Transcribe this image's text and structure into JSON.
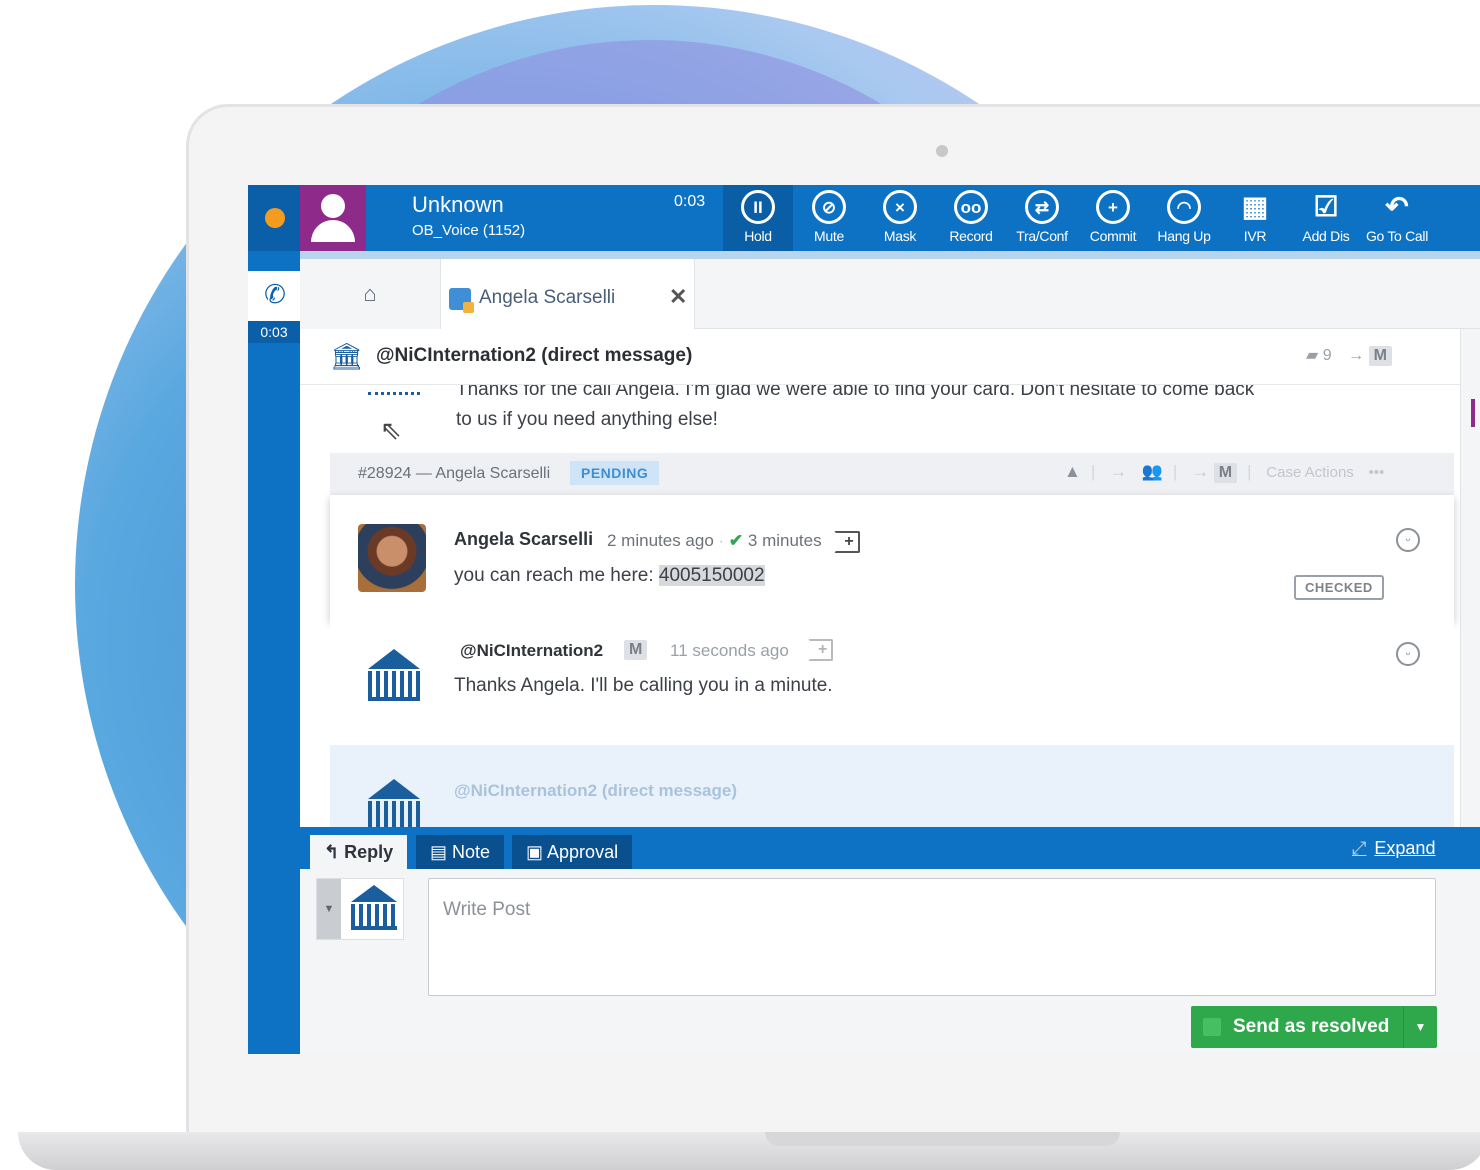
{
  "colors": {
    "brand_blue": "#0d72c4",
    "status_dot": "#f39c1f",
    "avatar_bg": "#8e2a8a",
    "send_green": "#2ea84a",
    "pending_badge": "#cfe4f7"
  },
  "call": {
    "caller_name": "Unknown",
    "caller_line": "OB_Voice (1152)",
    "timer": "0:03",
    "rail_timer": "0:03",
    "tools": [
      {
        "label": "Hold",
        "icon": "pause-icon",
        "glyph": "II",
        "active": true
      },
      {
        "label": "Mute",
        "icon": "mute-icon",
        "glyph": "⊘",
        "active": false
      },
      {
        "label": "Mask",
        "icon": "mask-icon",
        "glyph": "×",
        "active": false
      },
      {
        "label": "Record",
        "icon": "record-icon",
        "glyph": "oo",
        "active": false
      },
      {
        "label": "Tra/Conf",
        "icon": "transfer-icon",
        "glyph": "⇄",
        "active": false
      },
      {
        "label": "Commit",
        "icon": "plus-icon",
        "glyph": "+",
        "active": false
      },
      {
        "label": "Hang Up",
        "icon": "hangup-icon",
        "glyph": "◠",
        "active": false
      },
      {
        "label": "IVR",
        "icon": "keypad-icon",
        "glyph": "▦",
        "active": false
      },
      {
        "label": "Add Dis",
        "icon": "checkbox-icon",
        "glyph": "☑",
        "active": false
      },
      {
        "label": "Go To Call",
        "icon": "undo-icon",
        "glyph": "↶",
        "active": false
      }
    ]
  },
  "tabs": {
    "active_name": "Angela Scarselli",
    "close_glyph": "✕"
  },
  "conversation": {
    "title": "@NiCInternation2 (direct message)",
    "count": "9",
    "m_badge": "M",
    "previous_message": "Thanks for the call Angela. I'm glad we were able to find your card. Don't hesitate to come back to us if you need anything else!",
    "case": {
      "id": "#28924 — Angela Scarselli",
      "status": "PENDING",
      "m_badge": "M",
      "actions_label": "Case Actions",
      "more": "•••"
    },
    "customer_message": {
      "author": "Angela Scarselli",
      "time": "2 minutes ago",
      "response_time": "3 minutes",
      "text_prefix": "you can reach me here: ",
      "phone": "4005150002",
      "tag": "CHECKED"
    },
    "agent_message": {
      "author": "@NiCInternation2",
      "m_badge": "M",
      "time": "11 seconds ago",
      "text": "Thanks Angela. I'll be calling you in a minute."
    },
    "draft_author": "@NiCInternation2 (direct message)"
  },
  "composer": {
    "tabs": [
      "Reply",
      "Note",
      "Approval"
    ],
    "expand_label": "Expand",
    "placeholder": "Write Post",
    "send_label": "Send as resolved"
  }
}
